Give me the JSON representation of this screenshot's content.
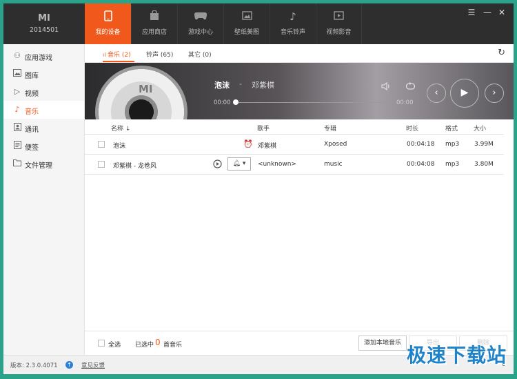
{
  "device": {
    "brand": "MI",
    "name": "2014501"
  },
  "nav_tabs": [
    {
      "label": "我的设备",
      "icon": "phone-icon",
      "active": true
    },
    {
      "label": "应用商店",
      "icon": "bag-icon"
    },
    {
      "label": "游戏中心",
      "icon": "gamepad-icon"
    },
    {
      "label": "壁纸美图",
      "icon": "picture-icon"
    },
    {
      "label": "音乐铃声",
      "icon": "music-note-icon"
    },
    {
      "label": "视频影音",
      "icon": "video-icon"
    }
  ],
  "sidebar": {
    "items": [
      {
        "label": "应用游戏",
        "icon": "apps-icon"
      },
      {
        "label": "图库",
        "icon": "gallery-icon"
      },
      {
        "label": "视频",
        "icon": "play-icon"
      },
      {
        "label": "音乐",
        "icon": "music-icon",
        "active": true
      },
      {
        "label": "通讯",
        "icon": "contacts-icon"
      },
      {
        "label": "便签",
        "icon": "note-icon"
      },
      {
        "label": "文件管理",
        "icon": "folder-icon"
      }
    ]
  },
  "subtabs": [
    {
      "label": "音乐 (2)",
      "active": true
    },
    {
      "label": "铃声 (65)"
    },
    {
      "label": "其它 (0)"
    }
  ],
  "player": {
    "disc_logo": "MI",
    "title": "泡沫",
    "separator": "-",
    "artist": "邓紫棋",
    "time_elapsed": "00:00",
    "time_total": "00:00",
    "progress": 0
  },
  "table": {
    "columns": {
      "name": "名称",
      "artist": "歌手",
      "album": "专辑",
      "duration": "时长",
      "format": "格式",
      "size": "大小"
    },
    "rows": [
      {
        "name": "泡沫",
        "artist": "邓紫棋",
        "album": "Xposed",
        "duration": "00:04:18",
        "format": "mp3",
        "size": "3.99M"
      },
      {
        "name": "邓紫棋 - 龙卷风",
        "artist": "<unknown>",
        "album": "music",
        "duration": "00:04:08",
        "format": "mp3",
        "size": "3.80M"
      }
    ]
  },
  "footer": {
    "select_all": "全选",
    "selected_prefix": "已选中",
    "selected_count": "0",
    "selected_suffix": "首音乐",
    "add_button": "添加本地音乐",
    "export_button": "导出",
    "delete_button": "删除"
  },
  "statusbar": {
    "version": "版本: 2.3.0.4071",
    "feedback": "意见反馈",
    "right_text": "0"
  },
  "watermark": "极速下载站",
  "colors": {
    "accent": "#f0581c",
    "topbar": "#2e2e2e",
    "frame": "#2aa38a",
    "watermark": "#1f83c9"
  }
}
